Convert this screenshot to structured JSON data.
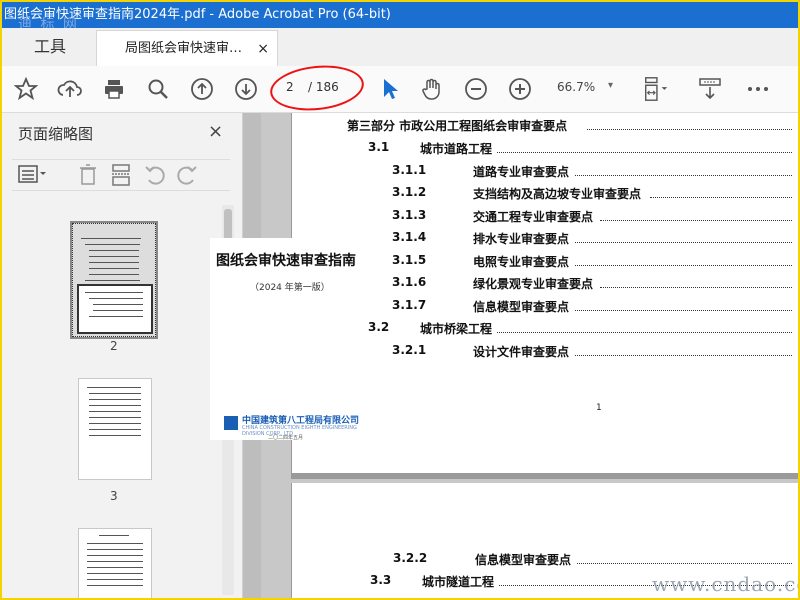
{
  "window": {
    "title": "图纸会审快速审查指南2024年.pdf - Adobe Acrobat Pro (64-bit)",
    "watermark_top": "迪 标 网"
  },
  "tabs": {
    "tools_label": "工具",
    "doc_label": "局图纸会审快速审…",
    "close_glyph": "×"
  },
  "toolbar": {
    "current_page": "2",
    "total_pages": "/ 186",
    "zoom": "66.7%",
    "zoom_caret": "▾",
    "icons": [
      "star-icon",
      "cloud-upload-icon",
      "print-icon",
      "search-icon",
      "page-up-icon",
      "page-down-icon",
      "select-cursor-icon",
      "hand-icon",
      "zoom-out-icon",
      "zoom-in-icon",
      "fit-page-icon",
      "scroll-mode-icon",
      "more-icon"
    ]
  },
  "sidebar": {
    "title": "页面缩略图",
    "close_glyph": "×",
    "thumbnails": [
      {
        "label": "2",
        "selected": true
      },
      {
        "label": "3",
        "selected": false
      },
      {
        "label": "",
        "selected": false
      }
    ]
  },
  "document": {
    "toc": [
      {
        "num": "",
        "text": "第三部分 市政公用工程图纸会审审查要点"
      },
      {
        "num": "3.1",
        "text": "城市道路工程"
      },
      {
        "num": "3.1.1",
        "text": "道路专业审查要点"
      },
      {
        "num": "3.1.2",
        "text": "支挡结构及高边坡专业审查要点"
      },
      {
        "num": "3.1.3",
        "text": "交通工程专业审查要点"
      },
      {
        "num": "3.1.4",
        "text": "排水专业审查要点"
      },
      {
        "num": "3.1.5",
        "text": "电照专业审查要点"
      },
      {
        "num": "3.1.6",
        "text": "绿化景观专业审查要点"
      },
      {
        "num": "3.1.7",
        "text": "信息模型审查要点"
      },
      {
        "num": "3.2",
        "text": "城市桥梁工程"
      },
      {
        "num": "3.2.1",
        "text": "设计文件审查要点"
      }
    ],
    "page_number": "1",
    "toc_page2": [
      {
        "num": "3.2.2",
        "text": "信息模型审查要点"
      },
      {
        "num": "3.3",
        "text": "城市隧道工程"
      }
    ]
  },
  "cover_popup": {
    "title": "图纸会审快速审查指南",
    "subtitle": "（2024 年第一版）",
    "company": "中国建筑第八工程局有限公司",
    "company_en": "CHINA CONSTRUCTION EIGHTH ENGINEERING DIVISION CORP., LTD",
    "footer": "二〇二四年五月"
  },
  "watermark_bottom": "www.cndao.com"
}
